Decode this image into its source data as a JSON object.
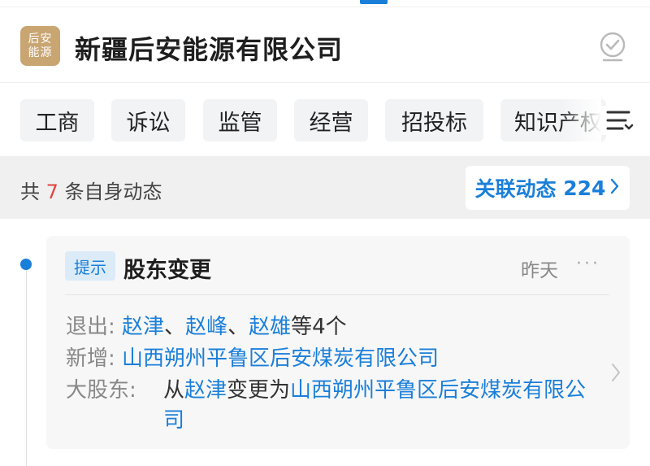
{
  "header": {
    "logo_text": [
      "后安",
      "能源"
    ],
    "company_name": "新疆后安能源有限公司",
    "verify_icon": "check-circle-icon"
  },
  "tabs": [
    {
      "label": "工商"
    },
    {
      "label": "诉讼"
    },
    {
      "label": "监管"
    },
    {
      "label": "经营"
    },
    {
      "label": "招投标"
    },
    {
      "label": "知识产权"
    }
  ],
  "menu_icon": "list-menu-icon",
  "summary": {
    "prefix": "共",
    "count": "7",
    "suffix": "条自身动态",
    "related_label": "关联动态",
    "related_count": "224"
  },
  "event": {
    "badge": "提示",
    "title": "股东变更",
    "time": "昨天",
    "more": "···",
    "exit_label": "退出:",
    "exit_names": [
      "赵津",
      "赵峰",
      "赵雄"
    ],
    "exit_sep": "、",
    "exit_suffix": "等4个",
    "add_label": "新增:",
    "add_name": "山西朔州平鲁区后安煤炭有限公司",
    "major_label": "大股东:",
    "major_from_word": "从",
    "major_from": "赵津",
    "major_to_word": "变更为",
    "major_to": "山西朔州平鲁区后安煤炭有限公司"
  },
  "colors": {
    "accent": "#1a7fd9",
    "count_red": "#e0443e",
    "logo_bg": "#c9a572"
  }
}
